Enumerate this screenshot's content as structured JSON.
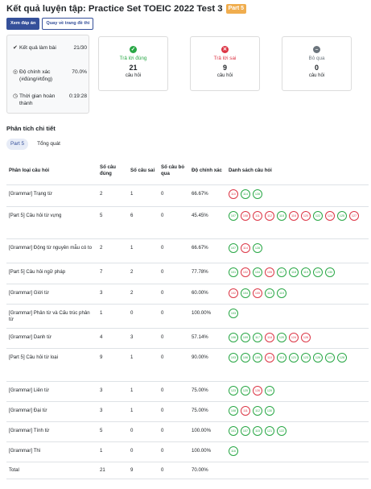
{
  "header": {
    "title": "Kết quả luyện tập: Practice Set TOEIC 2022 Test 3",
    "part_badge": "Part 5"
  },
  "buttons": {
    "view_answers": "Xem đáp án",
    "back_to_exam": "Quay về trang đề thi"
  },
  "summary": {
    "results_label": "Kết quả làm bài",
    "results_value": "21/30",
    "accuracy_label": "Độ chính xác (#đúng/#tổng)",
    "accuracy_value": "70.0%",
    "time_label": "Thời gian hoàn thành",
    "time_value": "0:19:28"
  },
  "stats": {
    "correct": {
      "label": "Trả lời đúng",
      "value": "21",
      "unit": "câu hỏi",
      "color": "#28a745",
      "icon": "check-circle-icon"
    },
    "wrong": {
      "label": "Trả lời sai",
      "value": "9",
      "unit": "câu hỏi",
      "color": "#dc3545",
      "icon": "x-circle-icon"
    },
    "skipped": {
      "label": "Bỏ qua",
      "value": "0",
      "unit": "câu hỏi",
      "color": "#6c757d",
      "icon": "minus-circle-icon"
    }
  },
  "detail": {
    "title": "Phân tích chi tiết",
    "tabs": [
      "Part 5",
      "Tổng quát"
    ],
    "headers": [
      "Phân loại câu hỏi",
      "Số câu đúng",
      "Số câu sai",
      "Số câu bỏ qua",
      "Độ chính xác",
      "Danh sách câu hỏi"
    ],
    "rows": [
      {
        "type": "[Grammar] Trạng từ",
        "correct": "2",
        "wrong": "1",
        "skipped": "0",
        "accuracy": "66.67%",
        "height": 27,
        "questions": [
          {
            "n": "110",
            "s": "w"
          },
          {
            "n": "114",
            "s": "c"
          },
          {
            "n": "128",
            "s": "c"
          }
        ]
      },
      {
        "type": "[Part 5] Câu hỏi từ vựng",
        "correct": "5",
        "wrong": "6",
        "skipped": "0",
        "accuracy": "45.45%",
        "height": 40,
        "questions": [
          {
            "n": "107",
            "s": "c"
          },
          {
            "n": "108",
            "s": "w"
          },
          {
            "n": "111",
            "s": "w"
          },
          {
            "n": "112",
            "s": "w"
          },
          {
            "n": "115",
            "s": "c"
          },
          {
            "n": "116",
            "s": "w"
          },
          {
            "n": "120",
            "s": "w"
          },
          {
            "n": "122",
            "s": "c"
          },
          {
            "n": "124",
            "s": "w"
          },
          {
            "n": "125",
            "s": "c"
          },
          {
            "n": "127",
            "s": "w"
          }
        ]
      },
      {
        "type": "[Grammar] Động từ nguyên mẫu có to",
        "correct": "2",
        "wrong": "1",
        "skipped": "0",
        "accuracy": "66.67%",
        "height": 30,
        "questions": [
          {
            "n": "107",
            "s": "c"
          },
          {
            "n": "114",
            "s": "w"
          },
          {
            "n": "128",
            "s": "c"
          }
        ]
      },
      {
        "type": "[Part 5] Câu hỏi ngữ pháp",
        "correct": "7",
        "wrong": "2",
        "skipped": "0",
        "accuracy": "77.78%",
        "height": 26,
        "questions": [
          {
            "n": "101",
            "s": "c"
          },
          {
            "n": "102",
            "s": "w"
          },
          {
            "n": "104",
            "s": "c"
          },
          {
            "n": "105",
            "s": "w"
          },
          {
            "n": "117",
            "s": "c"
          },
          {
            "n": "118",
            "s": "c"
          },
          {
            "n": "119",
            "s": "c"
          },
          {
            "n": "129",
            "s": "c"
          },
          {
            "n": "130",
            "s": "c"
          }
        ]
      },
      {
        "type": "[Grammar] Giới từ",
        "correct": "3",
        "wrong": "2",
        "skipped": "0",
        "accuracy": "60.00%",
        "height": 25,
        "questions": [
          {
            "n": "102",
            "s": "w"
          },
          {
            "n": "104",
            "s": "c"
          },
          {
            "n": "105",
            "s": "w"
          },
          {
            "n": "113",
            "s": "c"
          },
          {
            "n": "119",
            "s": "c"
          }
        ]
      },
      {
        "type": "[Grammar] Phân từ và Cấu trúc phân từ",
        "correct": "1",
        "wrong": "0",
        "skipped": "0",
        "accuracy": "100.00%",
        "height": 30,
        "questions": [
          {
            "n": "103",
            "s": "c"
          }
        ]
      },
      {
        "type": "[Grammar] Danh từ",
        "correct": "4",
        "wrong": "3",
        "skipped": "0",
        "accuracy": "57.14%",
        "height": 25,
        "questions": [
          {
            "n": "106",
            "s": "c"
          },
          {
            "n": "109",
            "s": "c"
          },
          {
            "n": "117",
            "s": "c"
          },
          {
            "n": "118",
            "s": "w"
          },
          {
            "n": "120",
            "s": "c"
          },
          {
            "n": "124",
            "s": "w"
          },
          {
            "n": "126",
            "s": "w"
          }
        ]
      },
      {
        "type": "[Part 5] Câu hỏi từ loại",
        "correct": "9",
        "wrong": "1",
        "skipped": "0",
        "accuracy": "90.00%",
        "height": 41,
        "questions": [
          {
            "n": "103",
            "s": "c"
          },
          {
            "n": "106",
            "s": "c"
          },
          {
            "n": "109",
            "s": "c"
          },
          {
            "n": "110",
            "s": "w"
          },
          {
            "n": "113",
            "s": "c"
          },
          {
            "n": "121",
            "s": "c"
          },
          {
            "n": "123",
            "s": "c"
          },
          {
            "n": "126",
            "s": "c"
          },
          {
            "n": "127",
            "s": "c"
          },
          {
            "n": "128",
            "s": "c"
          }
        ]
      },
      {
        "type": "[Grammar] Liên từ",
        "correct": "3",
        "wrong": "1",
        "skipped": "0",
        "accuracy": "75.00%",
        "height": 25,
        "questions": [
          {
            "n": "123",
            "s": "c"
          },
          {
            "n": "125",
            "s": "c"
          },
          {
            "n": "126",
            "s": "w"
          },
          {
            "n": "129",
            "s": "c"
          }
        ]
      },
      {
        "type": "[Grammar] Đại từ",
        "correct": "3",
        "wrong": "1",
        "skipped": "0",
        "accuracy": "75.00%",
        "height": 25,
        "questions": [
          {
            "n": "108",
            "s": "c"
          },
          {
            "n": "111",
            "s": "w"
          },
          {
            "n": "112",
            "s": "c"
          },
          {
            "n": "130",
            "s": "c"
          }
        ]
      },
      {
        "type": "[Grammar] Tính từ",
        "correct": "5",
        "wrong": "0",
        "skipped": "0",
        "accuracy": "100.00%",
        "height": 25,
        "questions": [
          {
            "n": "101",
            "s": "c"
          },
          {
            "n": "107",
            "s": "c"
          },
          {
            "n": "115",
            "s": "c"
          },
          {
            "n": "121",
            "s": "c"
          },
          {
            "n": "122",
            "s": "c"
          }
        ]
      },
      {
        "type": "[Grammar] Thì",
        "correct": "1",
        "wrong": "0",
        "skipped": "0",
        "accuracy": "100.00%",
        "height": 25,
        "questions": [
          {
            "n": "116",
            "s": "c"
          }
        ]
      }
    ],
    "total": {
      "label": "Total",
      "correct": "21",
      "wrong": "9",
      "skipped": "0",
      "accuracy": "70.00%"
    }
  }
}
